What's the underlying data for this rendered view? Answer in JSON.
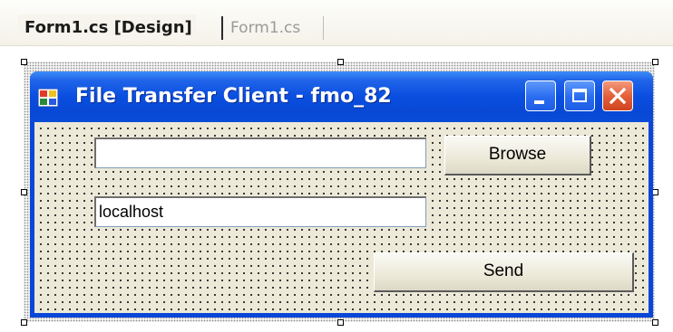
{
  "tabs": [
    {
      "label": "Form1.cs [Design]",
      "active": true
    },
    {
      "label": "Form1.cs",
      "active": false
    }
  ],
  "form": {
    "title": "File Transfer Client - fmo_82",
    "caption_buttons": [
      "minimize-icon",
      "maximize-icon",
      "close-icon"
    ],
    "file_path_value": "",
    "host_value": "localhost",
    "browse_label": "Browse",
    "send_label": "Send"
  },
  "colors": {
    "titlebar": "#0a4ee0",
    "client_background": "#ece9d8",
    "close_button": "#e4603a"
  }
}
